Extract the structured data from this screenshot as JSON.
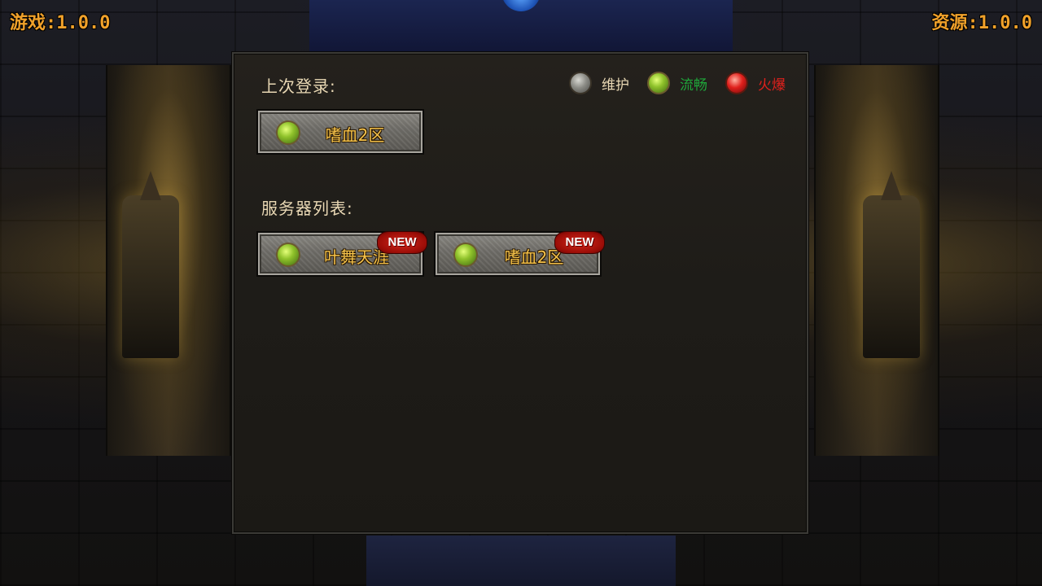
{
  "header": {
    "game_version": "游戏:1.0.0",
    "resource_version": "资源:1.0.0"
  },
  "panel": {
    "last_login_label": "上次登录:",
    "server_list_label": "服务器列表:",
    "legend": [
      {
        "label": "维护",
        "status": "maintenance",
        "color": "#e9d8b4",
        "icon": "gray-orb-icon"
      },
      {
        "label": "流畅",
        "status": "smooth",
        "color": "#1fa53a",
        "icon": "green-orb-icon"
      },
      {
        "label": "火爆",
        "status": "busy",
        "color": "#e0201c",
        "icon": "red-orb-icon"
      }
    ],
    "last_login_server": {
      "name": "嗜血2区",
      "status": "smooth"
    },
    "servers": [
      {
        "name": "叶舞天涯",
        "status": "smooth",
        "badge": "NEW"
      },
      {
        "name": "嗜血2区",
        "status": "smooth",
        "badge": "NEW"
      }
    ]
  },
  "colors": {
    "version_text": "#f0a12a",
    "server_name": "#f5c24a",
    "label_text": "#e9d8b4"
  }
}
